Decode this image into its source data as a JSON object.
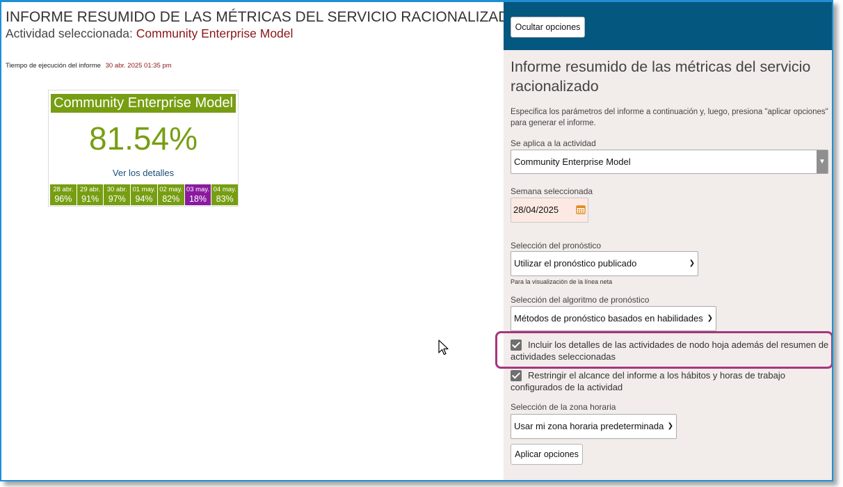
{
  "report": {
    "title": "INFORME RESUMIDO DE LAS MÉTRICAS DEL SERVICIO RACIONALIZADO",
    "activity_label": "Actividad seleccionada:",
    "activity_value": "Community Enterprise Model",
    "runtime_label": "Tiempo de ejecución del informe",
    "runtime_value": "30 abr. 2025 01:35 pm"
  },
  "card": {
    "title": "Community Enterprise Model",
    "value": "81.54%",
    "details_link": "Ver los detalles",
    "days": [
      {
        "date": "28 abr.",
        "pct": "96%"
      },
      {
        "date": "29 abr.",
        "pct": "91%"
      },
      {
        "date": "30 abr.",
        "pct": "97%"
      },
      {
        "date": "01 may.",
        "pct": "94%"
      },
      {
        "date": "02 may.",
        "pct": "82%"
      },
      {
        "date": "03 may.",
        "pct": "18%"
      },
      {
        "date": "04 may.",
        "pct": "83%"
      }
    ]
  },
  "colors": {
    "good": "#779e12",
    "low": "#8b1aa0",
    "header": "#04577f",
    "panel_bg": "#f2ecea",
    "highlight": "#a7357e"
  },
  "panel": {
    "hide_button": "Ocultar opciones",
    "title": "Informe resumido de las métricas del servicio racionalizado",
    "description": "Especifica los parámetros del informe a continuación y, luego, presiona \"aplicar opciones\" para generar el informe.",
    "activity_label": "Se aplica a la actividad",
    "activity_value": "Community Enterprise Model",
    "week_label": "Semana seleccionada",
    "week_value": "28/04/2025",
    "forecast_label": "Selección del pronóstico",
    "forecast_value": "Utilizar el pronóstico publicado",
    "forecast_help": "Para la visualización de la línea neta",
    "algorithm_label": "Selección del algoritmo de pronóstico",
    "algorithm_value": "Métodos de pronóstico basados en habilidades",
    "check_leaf": "Incluir los detalles de las actividades de nodo hoja además del resumen de actividades seleccionadas",
    "check_restrict": "Restringir el alcance del informe a los hábitos y horas de trabajo configurados de la actividad",
    "timezone_label": "Selección de la zona horaria",
    "timezone_value": "Usar mi zona horaria predeterminada",
    "apply_button": "Aplicar opciones"
  }
}
